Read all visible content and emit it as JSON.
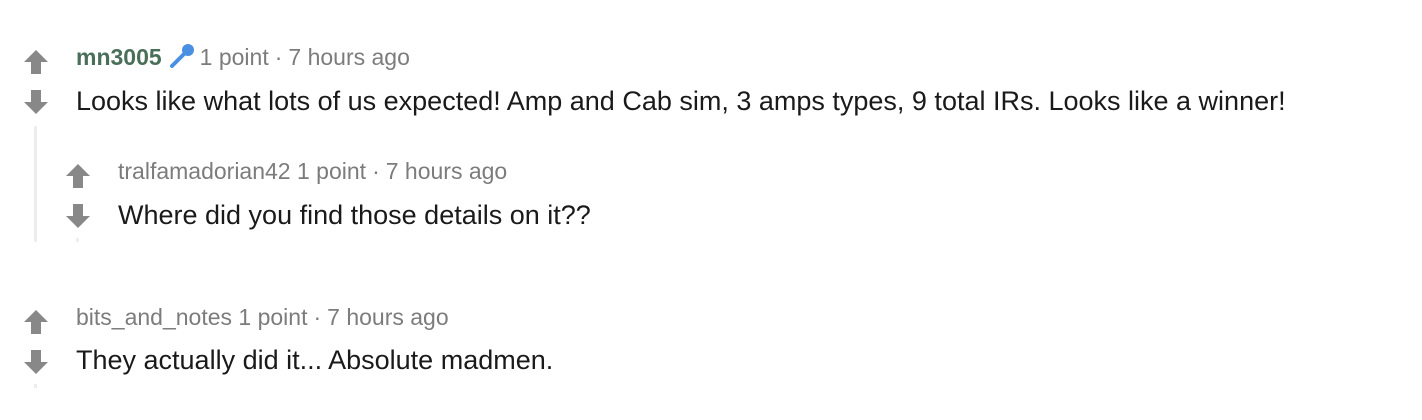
{
  "comments": [
    {
      "author": "mn3005",
      "flair_icon": "microphone-icon",
      "score": "1 point",
      "separator": "·",
      "time": "7 hours ago",
      "body": "Looks like what lots of us expected! Amp and Cab sim, 3 amps types, 9 total IRs. Looks like a winner!",
      "replies": [
        {
          "author": "tralfamadorian42",
          "score": "1 point",
          "separator": "·",
          "time": "7 hours ago",
          "body": "Where did you find those details on it??"
        }
      ]
    },
    {
      "author": "bits_and_notes",
      "score": "1 point",
      "separator": "·",
      "time": "7 hours ago",
      "body": "They actually did it... Absolute madmen."
    }
  ],
  "colors": {
    "arrow": "#888888",
    "author_highlight": "#4a6f59",
    "meta": "#7c7c7c",
    "body": "#1a1a1b",
    "flair": "#4a90e2",
    "thread_line": "#ededed"
  }
}
